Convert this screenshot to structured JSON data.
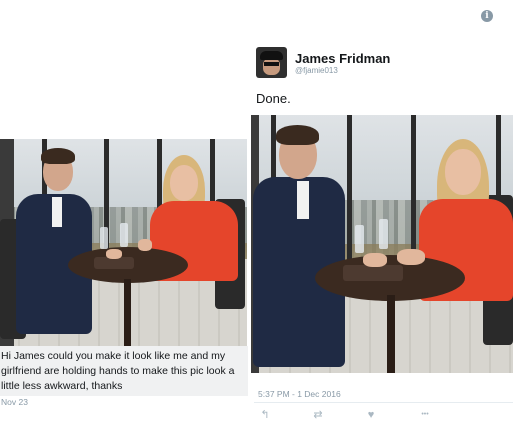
{
  "left_tweet": {
    "text": "Hi James could you make it look like me and my girlfriend are holding hands to make this pic look a little less awkward, thanks",
    "date": "Nov 23"
  },
  "right_tweet": {
    "display_name": "James Fridman",
    "handle": "@fjamie013",
    "text": "Done.",
    "timestamp": "5:37 PM - 1 Dec 2016"
  },
  "icons": {
    "info": "info-icon",
    "reply": "reply-icon",
    "retweet": "retweet-icon",
    "like": "heart-icon",
    "more": "more-icon"
  },
  "glyphs": {
    "info": "i",
    "reply": "↰",
    "retweet": "⇄",
    "like": "♥",
    "more": "•••"
  },
  "colors": {
    "text": "#14171a",
    "muted": "#8899a6",
    "caption_bg": "#f0f1f2",
    "shirt_red": "#e5452b",
    "suit_navy": "#1f2a44"
  }
}
